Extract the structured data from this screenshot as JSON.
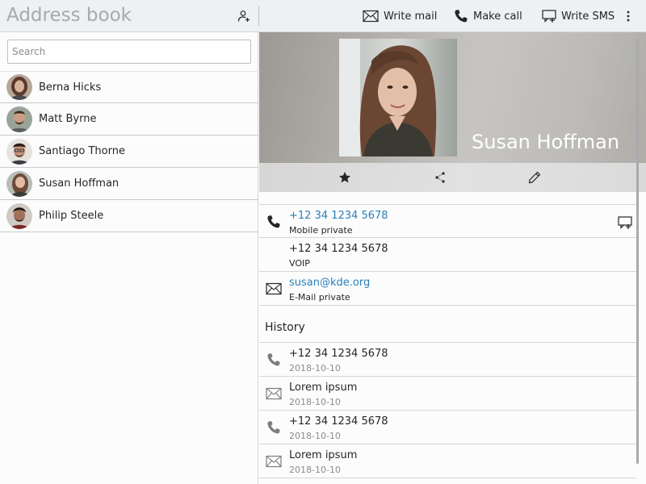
{
  "app": {
    "title": "Address book"
  },
  "toolbar": {
    "write_mail": "Write mail",
    "make_call": "Make call",
    "write_sms": "Write SMS"
  },
  "search": {
    "placeholder": "Search",
    "value": ""
  },
  "contacts": [
    {
      "name": "Berna Hicks"
    },
    {
      "name": "Matt Byrne"
    },
    {
      "name": "Santiago Thorne"
    },
    {
      "name": "Susan Hoffman"
    },
    {
      "name": "Philip Steele"
    }
  ],
  "selected": {
    "name": "Susan Hoffman",
    "details": [
      {
        "value": "+12 34 1234 5678",
        "label": "Mobile private",
        "icon": "phone-icon",
        "link": true,
        "action_icon": "sms-icon"
      },
      {
        "value": "+12 34 1234 5678",
        "label": "VOIP",
        "icon": "",
        "link": false
      },
      {
        "value": "susan@kde.org",
        "label": "E-Mail private",
        "icon": "mail-icon",
        "link": true
      }
    ],
    "history_title": "History",
    "history": [
      {
        "value": "+12 34 1234 5678",
        "date": "2018-10-10",
        "icon": "phone-icon"
      },
      {
        "value": "Lorem ipsum",
        "date": "2018-10-10",
        "icon": "mail-icon"
      },
      {
        "value": "+12 34 1234 5678",
        "date": "2018-10-10",
        "icon": "phone-icon"
      },
      {
        "value": "Lorem ipsum",
        "date": "2018-10-10",
        "icon": "mail-icon"
      }
    ]
  },
  "colors": {
    "link": "#2980b9",
    "text": "#232627",
    "toolbar_bg": "#eff0f1"
  }
}
